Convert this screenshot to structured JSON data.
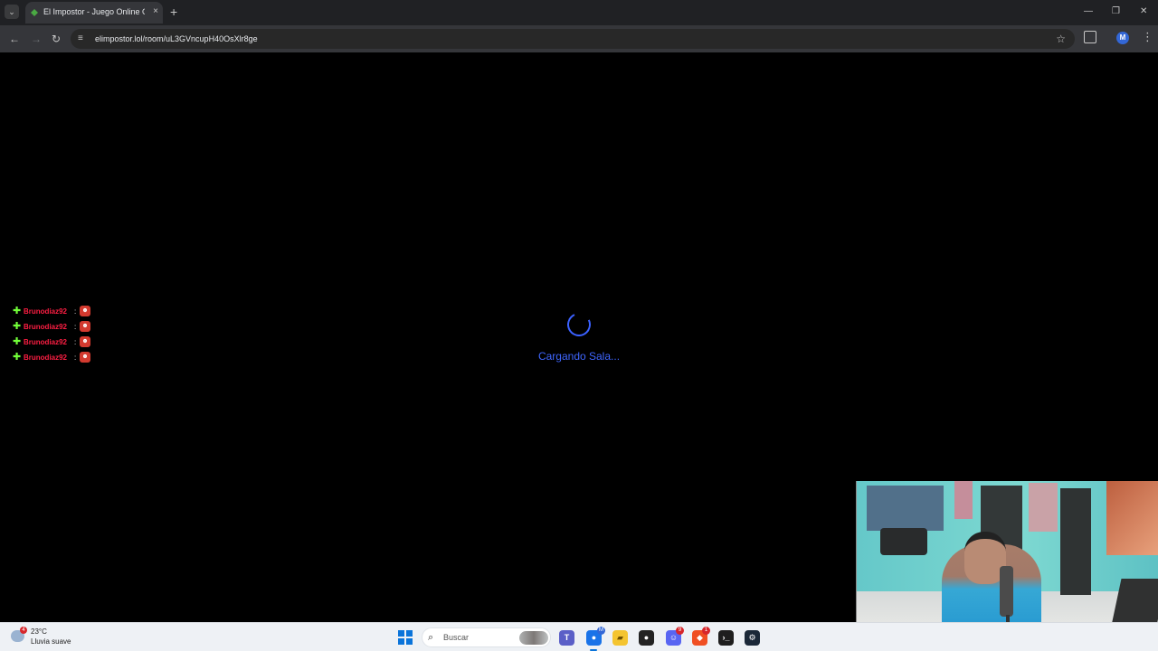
{
  "browser": {
    "tab_title": "El Impostor - Juego Online Gratis",
    "url": "elimpostor.lol/room/uL3GVncupH40OsXlr8ge",
    "profile_initial": "M"
  },
  "page": {
    "loading_text": "Cargando Sala...",
    "chat_entries": [
      {
        "username": "Brunodiaz92",
        "separator": ":"
      },
      {
        "username": "Brunodiaz92",
        "separator": ":"
      },
      {
        "username": "Brunodiaz92",
        "separator": ":"
      },
      {
        "username": "Brunodiaz92",
        "separator": ":"
      }
    ]
  },
  "taskbar": {
    "weather_badge": "4",
    "temperature": "23°C",
    "weather_condition": "Lluvia suave",
    "search_label": "Buscar",
    "discord_badge": "9",
    "brave_badge": "1"
  },
  "colors": {
    "background": "#000000",
    "loading_accent": "#3f66ff",
    "chat_username": "#ff1e43",
    "chat_plus": "#72ff39",
    "taskbar_accent": "#0a74da"
  },
  "icons": {
    "tab_favicon": "green-leaf-icon",
    "loading_spinner": "loading-spinner-icon",
    "chat_join": "plus-icon",
    "chat_emote": "devil-emote-icon"
  }
}
